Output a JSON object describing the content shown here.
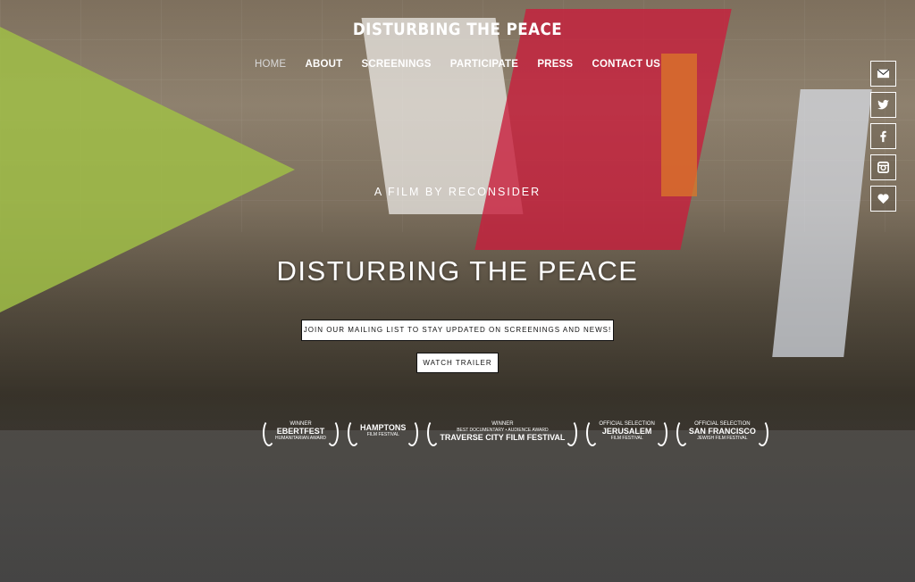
{
  "site": {
    "title": "DISTURBING THE PEACE"
  },
  "nav": {
    "items": [
      {
        "label": "HOME",
        "active": true
      },
      {
        "label": "ABOUT"
      },
      {
        "label": "SCREENINGS"
      },
      {
        "label": "PARTICIPATE"
      },
      {
        "label": "PRESS"
      },
      {
        "label": "CONTACT US"
      }
    ]
  },
  "social": [
    "envelope-icon",
    "twitter-icon",
    "facebook-icon",
    "instagram-icon",
    "heart-icon"
  ],
  "hero": {
    "tagline": "A FILM BY RECONSIDER",
    "headline": "DISTURBING THE PEACE",
    "mailing_button": "JOIN OUR MAILING LIST TO STAY UPDATED ON SCREENINGS AND NEWS!",
    "trailer_button": "WATCH TRAILER"
  },
  "laurels": [
    {
      "top": "WINNER",
      "big": "EBERTFEST",
      "sub": "HUMANITARIAN AWARD"
    },
    {
      "top": "",
      "big": "HAMPTONS",
      "sub": "FILM FESTIVAL"
    },
    {
      "top": "WINNER",
      "big": "TRAVERSE CITY FILM FESTIVAL",
      "sub": "BEST DOCUMENTARY • AUDIENCE AWARD"
    },
    {
      "top": "OFFICIAL SELECTION",
      "big": "JERUSALEM",
      "sub": "FILM FESTIVAL"
    },
    {
      "top": "OFFICIAL SELECTION",
      "big": "SAN FRANCISCO",
      "sub": "JEWISH FILM FESTIVAL"
    }
  ]
}
